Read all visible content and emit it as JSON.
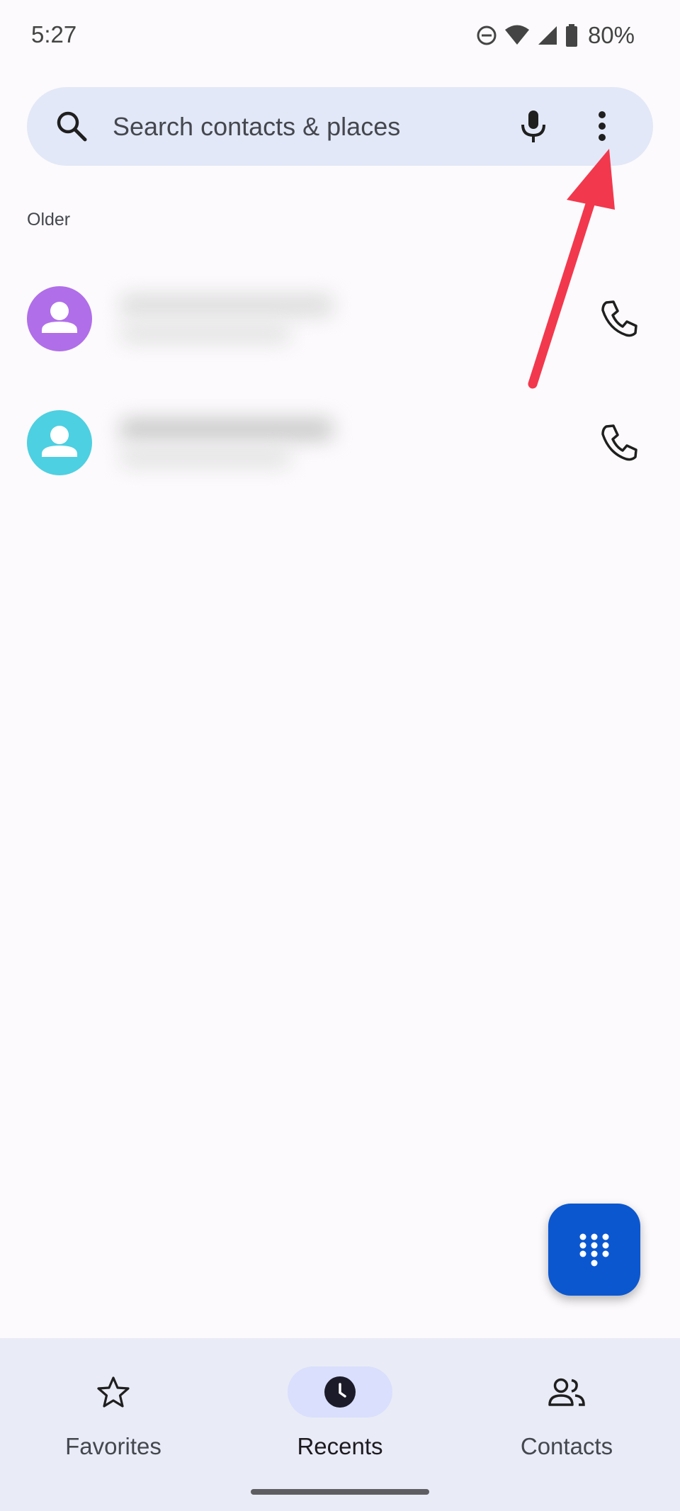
{
  "status_bar": {
    "time": "5:27",
    "battery": "80%",
    "icons": [
      "do-not-disturb-icon",
      "wifi-icon",
      "cellular-signal-icon",
      "battery-icon"
    ]
  },
  "search": {
    "placeholder": "Search contacts & places",
    "icons": [
      "search-icon",
      "mic-icon",
      "more-vert-icon"
    ]
  },
  "recents": {
    "section_header": "Older",
    "calls": [
      {
        "name": "",
        "detail": "",
        "avatar_color": "#b06ee9",
        "call_icon": "phone-icon"
      },
      {
        "name": "",
        "detail": "",
        "avatar_color": "#4dd0e1",
        "call_icon": "phone-icon"
      }
    ]
  },
  "fab": {
    "icon": "dialpad-icon"
  },
  "bottom_nav": {
    "items": [
      {
        "label": "Favorites",
        "icon": "star-icon",
        "active": false
      },
      {
        "label": "Recents",
        "icon": "clock-icon",
        "active": true
      },
      {
        "label": "Contacts",
        "icon": "people-icon",
        "active": false
      }
    ]
  },
  "colors": {
    "background": "#fcfafc",
    "search_bar": "#e2e8f7",
    "fab": "#0b57d0",
    "nav_background": "#e9ebf6",
    "nav_active_pill": "#d9dffc",
    "annotation_arrow": "#f2384d"
  }
}
